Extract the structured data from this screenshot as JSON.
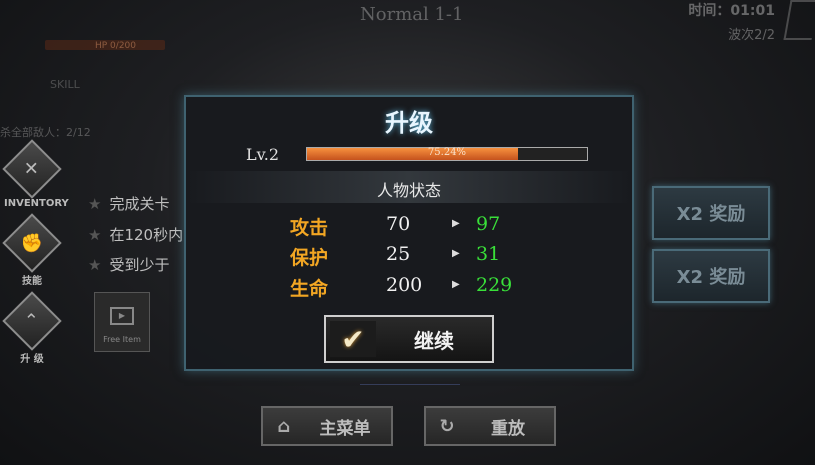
{
  "top": {
    "stage_title": "Normal 1-1",
    "timer": "时间：01:01",
    "wave": "波次2/2",
    "hp_text": "HP 0/200",
    "subtitle": "SKILL",
    "kill_count": "杀全部敌人：2/12"
  },
  "sidebar": [
    {
      "label": "INVENTORY",
      "icon": "shield-icon"
    },
    {
      "label": "技能",
      "icon": "fist-icon"
    },
    {
      "label": "升 级",
      "icon": "chevron-up-icon"
    }
  ],
  "quests": [
    "完成关卡",
    "在120秒内",
    "受到少于"
  ],
  "free_item": {
    "label": "Free Item"
  },
  "rewards": [
    "X2 奖励",
    "X2 奖励"
  ],
  "bottom": {
    "menu_label": "主菜单",
    "replay_label": "重放"
  },
  "modal": {
    "title": "升级",
    "level": "Lv.2",
    "xp_percent": 0.7524,
    "xp_text": "75.24%",
    "status_title": "人物状态",
    "stats": [
      {
        "name": "攻击",
        "old": "70",
        "new": "97"
      },
      {
        "name": "保护",
        "old": "25",
        "new": "31"
      },
      {
        "name": "生命",
        "old": "200",
        "new": "229"
      }
    ],
    "continue_label": "继续"
  },
  "colors": {
    "stat_name": "#f2a623",
    "stat_new": "#39e039",
    "xp_fill": "#f6913e"
  }
}
